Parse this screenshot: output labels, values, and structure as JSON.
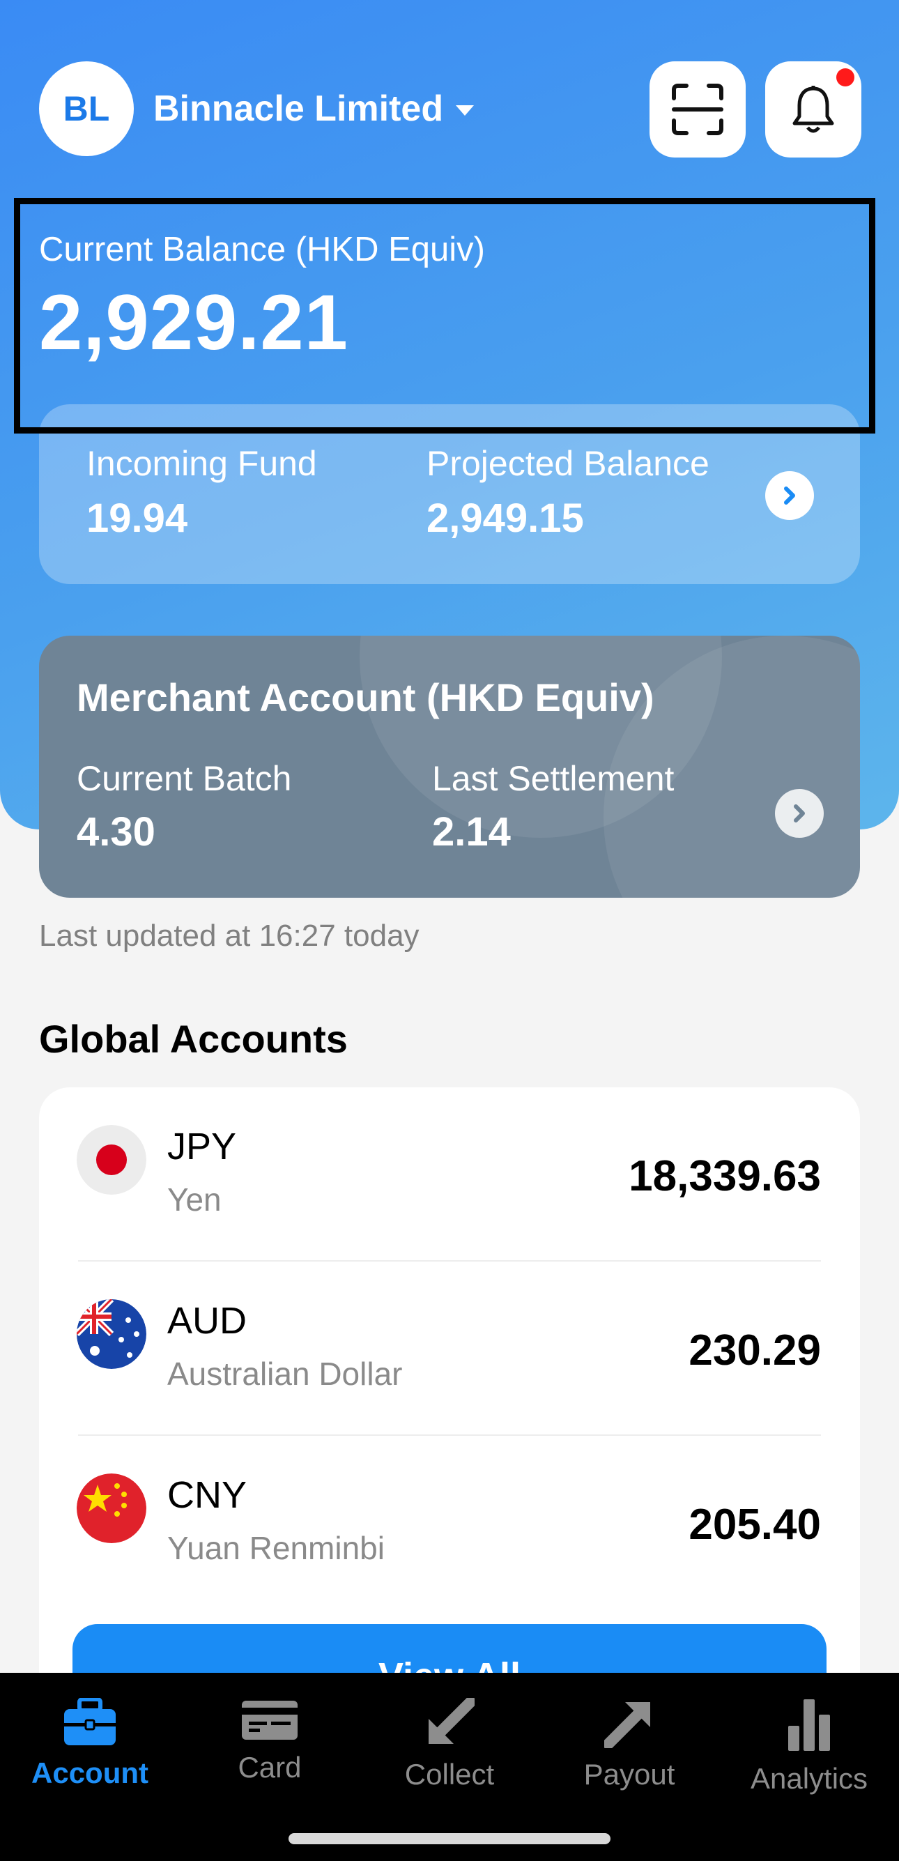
{
  "header": {
    "avatar_initials": "BL",
    "company_name": "Binnacle Limited",
    "scan_icon": "scan-icon",
    "bell_icon": "bell-icon"
  },
  "balance": {
    "label": "Current Balance (HKD Equiv)",
    "value": "2,929.21"
  },
  "funds": {
    "incoming_label": "Incoming Fund",
    "incoming_value": "19.94",
    "projected_label": "Projected Balance",
    "projected_value": "2,949.15"
  },
  "merchant": {
    "title": "Merchant Account (HKD Equiv)",
    "batch_label": "Current Batch",
    "batch_value": "4.30",
    "settlement_label": "Last Settlement",
    "settlement_value": "2.14"
  },
  "updated_text": "Last updated at 16:27 today",
  "global_accounts": {
    "title": "Global Accounts",
    "items": [
      {
        "code": "JPY",
        "name": "Yen",
        "amount": "18,339.63",
        "flag": "japan-flag-icon"
      },
      {
        "code": "AUD",
        "name": "Australian Dollar",
        "amount": "230.29",
        "flag": "australia-flag-icon"
      },
      {
        "code": "CNY",
        "name": "Yuan Renminbi",
        "amount": "205.40",
        "flag": "china-flag-icon"
      }
    ],
    "view_all_label": "View All"
  },
  "tabs": [
    {
      "label": "Account",
      "icon": "briefcase-icon",
      "active": true
    },
    {
      "label": "Card",
      "icon": "card-icon",
      "active": false
    },
    {
      "label": "Collect",
      "icon": "collect-arrow-icon",
      "active": false
    },
    {
      "label": "Payout",
      "icon": "payout-arrow-icon",
      "active": false
    },
    {
      "label": "Analytics",
      "icon": "analytics-icon",
      "active": false
    }
  ],
  "colors": {
    "accent": "#1e8ff7",
    "hero_gradient_start": "#3a8bf4",
    "merchant_card": "#6f8496",
    "notification_dot": "#ff1a1a"
  }
}
